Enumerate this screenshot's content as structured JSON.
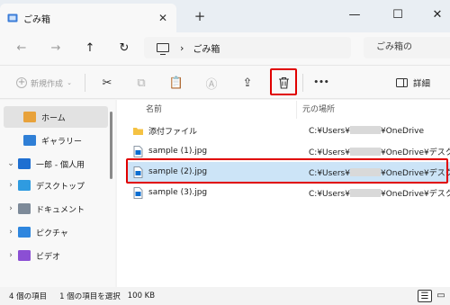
{
  "window": {
    "tab_title": "ごみ箱",
    "new_tab_label": "+",
    "minimize_label": "—",
    "maximize_label": "☐",
    "close_label": "✕"
  },
  "navigation": {
    "address_path": "ごみ箱",
    "search_placeholder": "ごみ箱の"
  },
  "toolbar": {
    "new_item_label": "新規作成",
    "more_label": "•••",
    "details_label": "詳細"
  },
  "sidebar": {
    "items": [
      {
        "label": "ホーム",
        "icon": "home-icon",
        "selected": true,
        "has_arrow": false
      },
      {
        "label": "ギャラリー",
        "icon": "gallery-icon",
        "selected": false,
        "has_arrow": false
      },
      {
        "label": "一郎 - 個人用",
        "icon": "onedrive-cloud-icon",
        "selected": false,
        "has_arrow": true,
        "expanded": true
      },
      {
        "label": "デスクトップ",
        "icon": "desktop-folder-icon",
        "selected": false,
        "has_arrow": true
      },
      {
        "label": "ドキュメント",
        "icon": "documents-folder-icon",
        "selected": false,
        "has_arrow": true
      },
      {
        "label": "ピクチャ",
        "icon": "pictures-folder-icon",
        "selected": false,
        "has_arrow": true
      },
      {
        "label": "ビデオ",
        "icon": "videos-folder-icon",
        "selected": false,
        "has_arrow": true
      }
    ]
  },
  "file_list": {
    "columns": {
      "name": "名前",
      "original_location": "元の場所"
    },
    "rows": [
      {
        "name": "添付ファイル",
        "type": "folder",
        "loc_prefix": "C:¥Users¥",
        "loc_suffix": "¥OneDrive",
        "selected": false
      },
      {
        "name": "sample (1).jpg",
        "type": "image",
        "loc_prefix": "C:¥Users¥",
        "loc_suffix": "¥OneDrive¥デスクトップ",
        "selected": false
      },
      {
        "name": "sample (2).jpg",
        "type": "image",
        "loc_prefix": "C:¥Users¥",
        "loc_suffix": "¥OneDrive¥デスクトップ",
        "selected": true
      },
      {
        "name": "sample (3).jpg",
        "type": "image",
        "loc_prefix": "C:¥Users¥",
        "loc_suffix": "¥OneDrive¥デスクトップ",
        "selected": false
      }
    ]
  },
  "status": {
    "item_count": "4 個の項目",
    "selection": "1 個の項目を選択",
    "size": "100 KB"
  },
  "colors": {
    "highlight_red": "#e00000",
    "selection_blue": "#cce4f7",
    "folder_yellow": "#f5c243",
    "accent_blue": "#0a6ed1"
  }
}
